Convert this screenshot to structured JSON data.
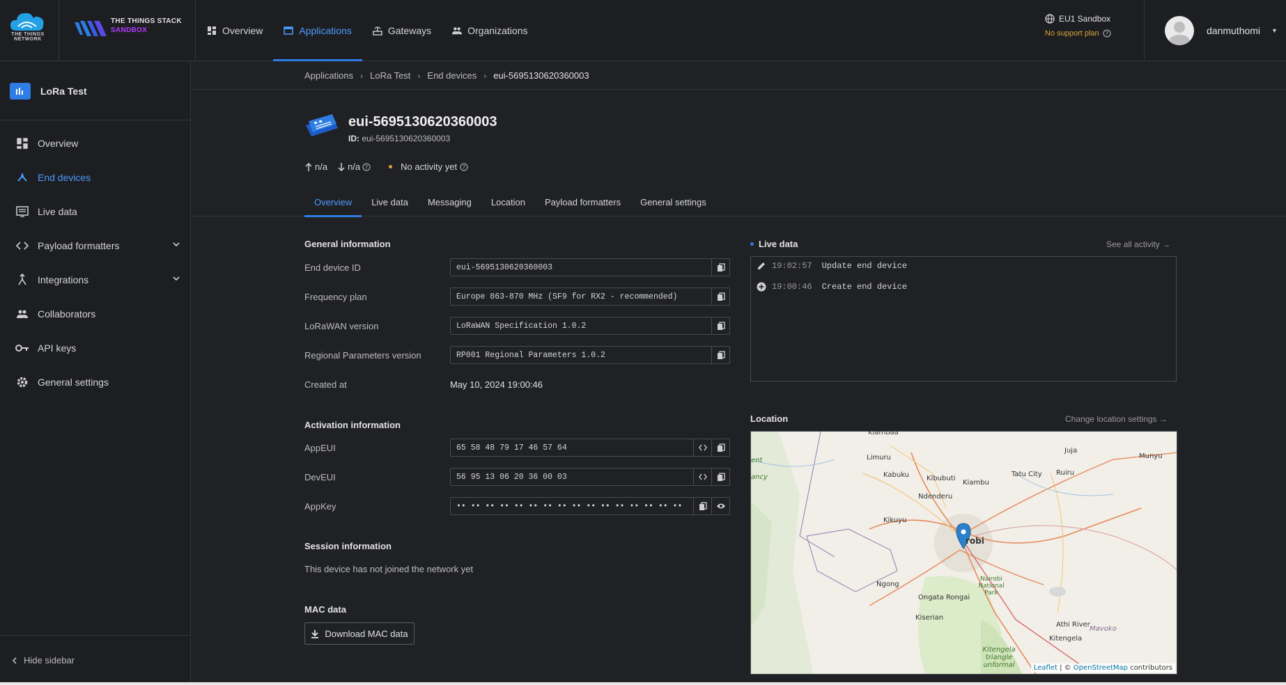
{
  "topbar": {
    "ttn_logo_text": "THE THINGS NETWORK",
    "tts_line1": "THE THINGS STACK",
    "tts_line2": "SANDBOX",
    "nav": [
      {
        "label": "Overview",
        "icon": "dashboard-icon"
      },
      {
        "label": "Applications",
        "icon": "application-icon"
      },
      {
        "label": "Gateways",
        "icon": "gateway-icon"
      },
      {
        "label": "Organizations",
        "icon": "organization-icon"
      }
    ],
    "active_nav": "Applications",
    "region": "EU1 Sandbox",
    "support_plan": "No support plan",
    "username": "danmuthomi"
  },
  "sidebar": {
    "app_name": "LoRa Test",
    "items": [
      {
        "label": "Overview",
        "icon": "dashboard-icon"
      },
      {
        "label": "End devices",
        "icon": "devices-icon"
      },
      {
        "label": "Live data",
        "icon": "list-icon"
      },
      {
        "label": "Payload formatters",
        "icon": "code-icon"
      },
      {
        "label": "Integrations",
        "icon": "integration-icon"
      },
      {
        "label": "Collaborators",
        "icon": "people-icon"
      },
      {
        "label": "API keys",
        "icon": "key-icon"
      },
      {
        "label": "General settings",
        "icon": "gear-icon"
      }
    ],
    "hide_label": "Hide sidebar"
  },
  "breadcrumb": [
    "Applications",
    "LoRa Test",
    "End devices",
    "eui-5695130620360003"
  ],
  "device": {
    "title": "eui-5695130620360003",
    "id_label": "ID:",
    "id": "eui-5695130620360003",
    "uplink": "n/a",
    "downlink": "n/a",
    "activity": "No activity yet"
  },
  "tabs": [
    "Overview",
    "Live data",
    "Messaging",
    "Location",
    "Payload formatters",
    "General settings"
  ],
  "general": {
    "title": "General information",
    "rows": [
      {
        "label": "End device ID",
        "value": "eui-5695130620360003"
      },
      {
        "label": "Frequency plan",
        "value": "Europe 863-870 MHz (SF9 for RX2 - recommended)"
      },
      {
        "label": "LoRaWAN version",
        "value": "LoRaWAN Specification 1.0.2"
      },
      {
        "label": "Regional Parameters version",
        "value": "RP001 Regional Parameters 1.0.2"
      }
    ],
    "created_label": "Created at",
    "created_value": "May 10, 2024 19:00:46"
  },
  "activation": {
    "title": "Activation information",
    "rows": [
      {
        "label": "AppEUI",
        "value": "65 58 48 79 17 46 57 64"
      },
      {
        "label": "DevEUI",
        "value": "56 95 13 06 20 36 00 03"
      },
      {
        "label": "AppKey",
        "value": "•• •• •• •• •• •• •• •• •• •• •• •• •• •• •• ••"
      }
    ]
  },
  "session": {
    "title": "Session information",
    "text": "This device has not joined the network yet"
  },
  "mac": {
    "title": "MAC data",
    "button": "Download MAC data"
  },
  "live_data": {
    "title": "Live data",
    "see_all": "See all activity →",
    "events": [
      {
        "time": "19:02:57",
        "message": "Update end device",
        "icon": "edit-icon"
      },
      {
        "time": "19:00:46",
        "message": "Create end device",
        "icon": "add-circle-icon"
      }
    ]
  },
  "location": {
    "title": "Location",
    "change": "Change location settings →",
    "map_labels": [
      "Limuru",
      "Kabuku",
      "Kibubuti",
      "Kiambu",
      "Tatu City",
      "Ruiru",
      "Juja",
      "Munyu",
      "Ndenderu",
      "Kikuyu",
      "robi",
      "Ngong",
      "Ongata Rongai",
      "Nairobi National Park",
      "Kiserian",
      "Athi River",
      "Mavoko",
      "Kitengela",
      "Kitengela triangle unformal",
      "Kiambaa",
      "ancy",
      "ent"
    ],
    "attribution_leaflet": "Leaflet",
    "attribution_sep": " | © ",
    "attribution_osm": "OpenStreetMap",
    "attribution_tail": " contributors"
  }
}
